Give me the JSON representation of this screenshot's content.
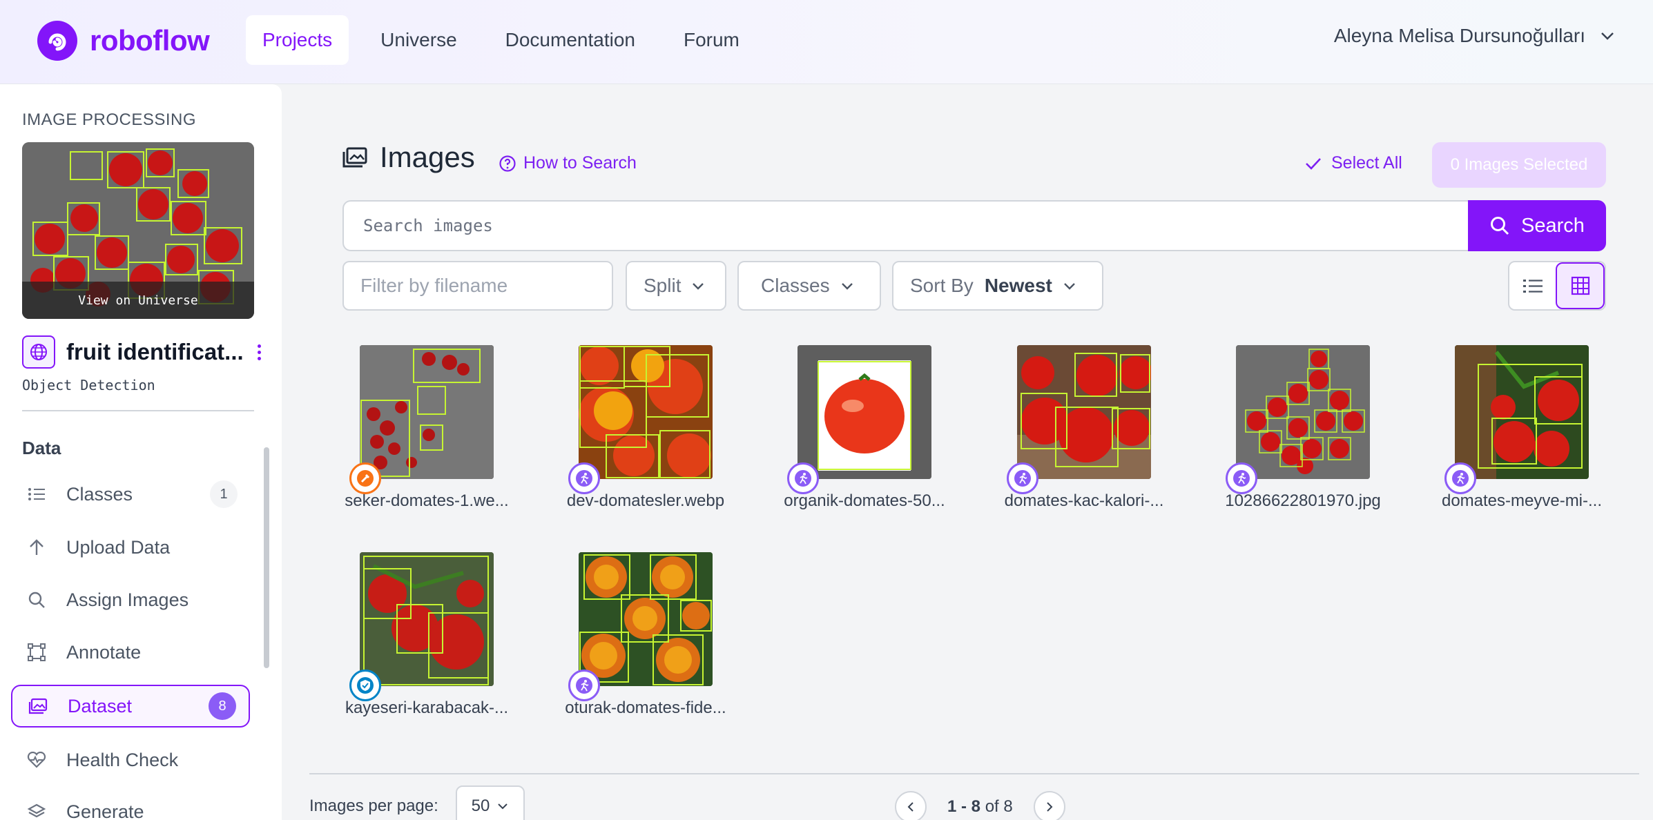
{
  "brand": {
    "name": "roboflow",
    "color": "#8315f9"
  },
  "nav": {
    "items": [
      {
        "label": "Projects",
        "active": true
      },
      {
        "label": "Universe"
      },
      {
        "label": "Documentation"
      },
      {
        "label": "Forum"
      }
    ],
    "user": "Aleyna Melisa Dursunoğulları"
  },
  "sidebar": {
    "section": "IMAGE PROCESSING",
    "thumb_label": "View on Universe",
    "project_name": "fruit identificat...",
    "project_type": "Object Detection",
    "data_heading": "Data",
    "items": [
      {
        "label": "Classes",
        "count": "1",
        "icon": "list-icon"
      },
      {
        "label": "Upload Data",
        "icon": "upload-icon"
      },
      {
        "label": "Assign Images",
        "icon": "search-icon"
      },
      {
        "label": "Annotate",
        "icon": "annotate-icon"
      },
      {
        "label": "Dataset",
        "count": "8",
        "icon": "images-icon",
        "active": true
      },
      {
        "label": "Health Check",
        "icon": "heartbeat-icon"
      },
      {
        "label": "Generate",
        "icon": "layers-icon"
      }
    ]
  },
  "main": {
    "title": "Images",
    "how_to_search": "How to Search",
    "select_all": "Select All",
    "selected": "0 Images Selected",
    "search_placeholder": "Search images",
    "search_button": "Search",
    "filter_placeholder": "Filter by filename",
    "split": "Split",
    "classes": "Classes",
    "sort_label": "Sort By",
    "sort_value": "Newest"
  },
  "images": [
    {
      "name": "seker-domates-1.we...",
      "badge": "orange"
    },
    {
      "name": "dev-domatesler.webp",
      "badge": "purple"
    },
    {
      "name": "organik-domates-50...",
      "badge": "purple"
    },
    {
      "name": "domates-kac-kalori-...",
      "badge": "purple"
    },
    {
      "name": "10286622801970.jpg",
      "badge": "purple"
    },
    {
      "name": "domates-meyve-mi-...",
      "badge": "purple"
    },
    {
      "name": "kayeseri-karabacak-...",
      "badge": "blue"
    },
    {
      "name": "oturak-domates-fide...",
      "badge": "purple"
    }
  ],
  "pagination": {
    "per_page_label": "Images per page:",
    "per_page": "50",
    "range": "1 - 8",
    "of": "of 8"
  }
}
